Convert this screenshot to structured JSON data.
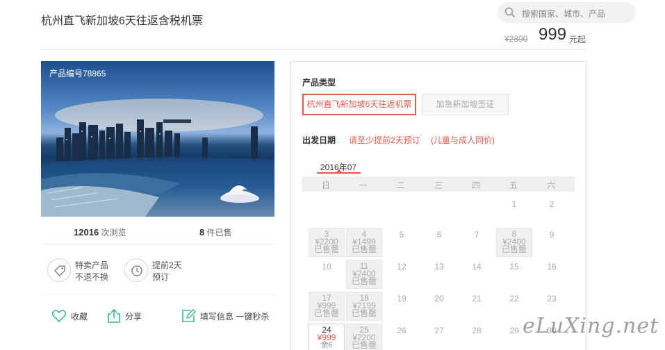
{
  "page_title": "杭州直飞新加坡6天往返含税机票",
  "search": {
    "placeholder": "搜索国家、城市、产品"
  },
  "price": {
    "original": "¥2800",
    "current": "999",
    "unit": "元起"
  },
  "product": {
    "code": "产品编号78865"
  },
  "stats": {
    "views_count": "12016",
    "views_label": "次浏览",
    "sold_count": "8",
    "sold_label": "件已售"
  },
  "badges": [
    {
      "line1": "特卖产品",
      "line2": "不退不换",
      "icon": "tag-icon"
    },
    {
      "line1": "提前2天",
      "line2": "预订",
      "icon": "clock-icon"
    }
  ],
  "actions": {
    "favorite": "收藏",
    "share": "分享",
    "fill": "填写信息 一键秒杀"
  },
  "booking": {
    "product_type_label": "产品类型",
    "options": [
      "杭州直飞新加坡6天往返机票",
      "加急新加坡签证"
    ],
    "date_label": "出发日期",
    "hint1": "请至少提前2天预订",
    "hint2": "(儿童与成人同价)",
    "month": "2016年07",
    "weekdays": [
      "日",
      "一",
      "二",
      "三",
      "四",
      "五",
      "六"
    ]
  },
  "calendar": [
    {
      "d": "1",
      "type": "plain"
    },
    {
      "d": "2",
      "type": "plain"
    },
    {
      "d": "3",
      "type": "box",
      "price": "¥2200",
      "status": "已售罄"
    },
    {
      "d": "4",
      "type": "box",
      "price": "¥1499",
      "status": "已售罄"
    },
    {
      "d": "5",
      "type": "plain"
    },
    {
      "d": "6",
      "type": "plain"
    },
    {
      "d": "7",
      "type": "plain"
    },
    {
      "d": "8",
      "type": "box",
      "price": "¥2400",
      "status": "已售罄"
    },
    {
      "d": "9",
      "type": "plain"
    },
    {
      "d": "10",
      "type": "plain"
    },
    {
      "d": "11",
      "type": "box",
      "price": "¥2400",
      "status": "已售罄"
    },
    {
      "d": "12",
      "type": "plain"
    },
    {
      "d": "13",
      "type": "plain"
    },
    {
      "d": "14",
      "type": "plain"
    },
    {
      "d": "15",
      "type": "plain"
    },
    {
      "d": "16",
      "type": "plain"
    },
    {
      "d": "17",
      "type": "box",
      "price": "¥999",
      "status": "已售罄"
    },
    {
      "d": "18",
      "type": "box",
      "price": "¥2199",
      "status": "已售罄"
    },
    {
      "d": "19",
      "type": "plain"
    },
    {
      "d": "20",
      "type": "plain"
    },
    {
      "d": "21",
      "type": "plain"
    },
    {
      "d": "22",
      "type": "plain"
    },
    {
      "d": "23",
      "type": "plain"
    },
    {
      "d": "24",
      "type": "sel",
      "price": "¥999",
      "status": "余6"
    },
    {
      "d": "25",
      "type": "box",
      "price": "¥2200",
      "status": "已售罄"
    },
    {
      "d": "26",
      "type": "plain"
    },
    {
      "d": "27",
      "type": "plain"
    },
    {
      "d": "28",
      "type": "plain"
    },
    {
      "d": "29",
      "type": "plain"
    },
    {
      "d": "30",
      "type": "plain"
    }
  ],
  "watermark": "eLuXing.net",
  "colors": {
    "accent": "#e05b4b",
    "icon_green": "#3cb4a0"
  }
}
